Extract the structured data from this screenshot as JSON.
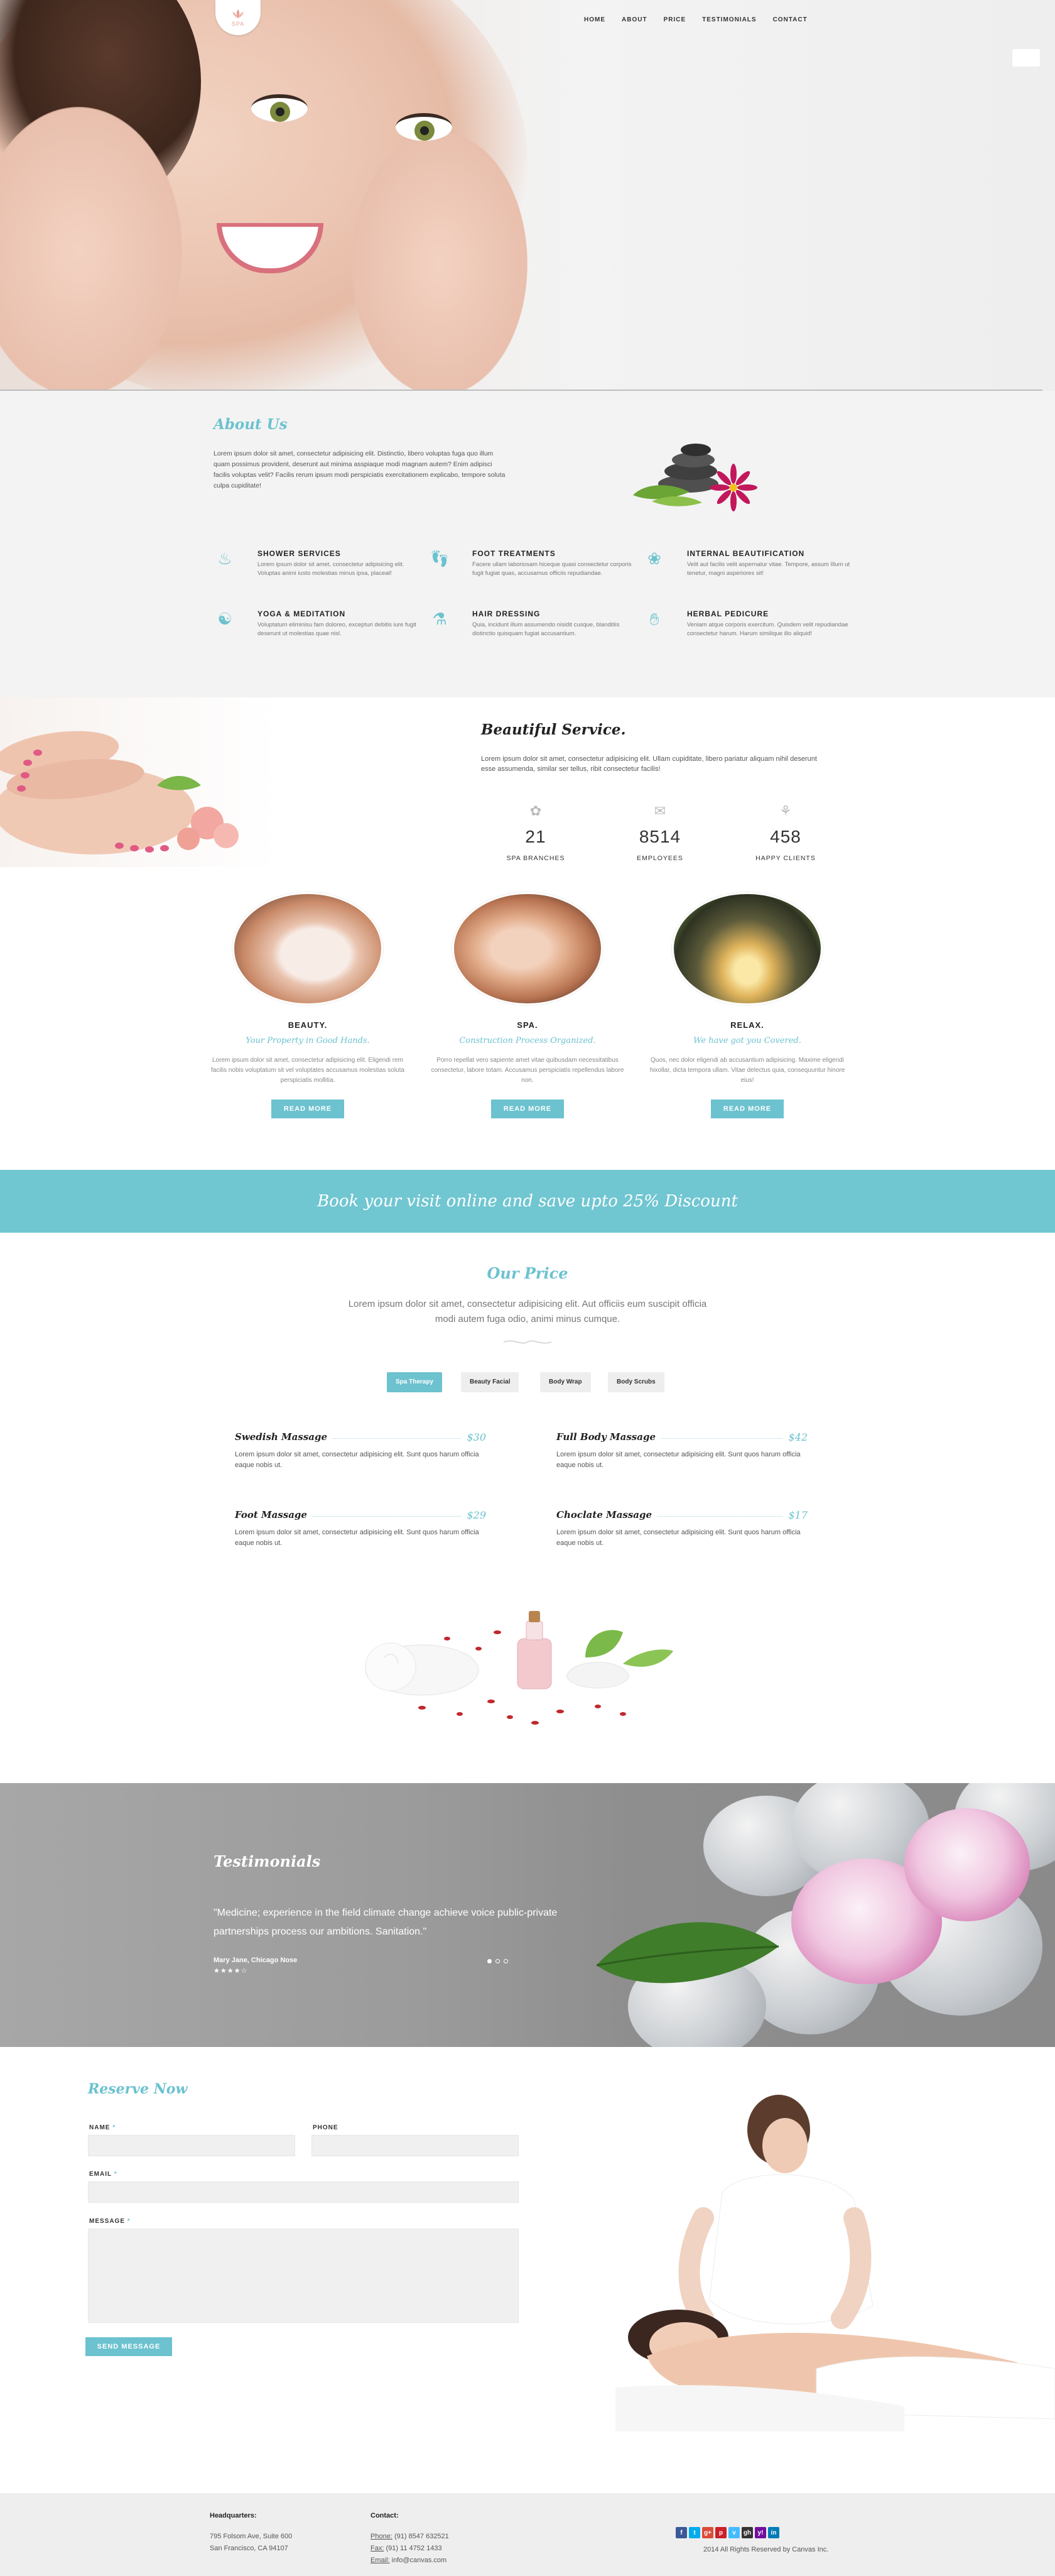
{
  "hero": {
    "logo_text": "SPA"
  },
  "nav": {
    "items": [
      "HOME",
      "ABOUT",
      "PRICE",
      "TESTIMONIALS",
      "CONTACT"
    ]
  },
  "about": {
    "title": "About Us",
    "text": "Lorem ipsum dolor sit amet, consectetur adipisicing elit. Distinctio, libero voluptas fuga quo illum quam possimus provident, deserunt aut minima asspiaque modi magnam autem? Enim adipisci facilis voluptas velit? Facilis rerum ipsum modi perspiciatis exercitationem explicabo, tempore soluta culpa cupiditate!",
    "features": [
      {
        "icon": "shower-icon",
        "title": "SHOWER SERVICES",
        "text": "Lorem ipsum dolor sit amet, consectetur adipisicing elit. Voluptas animi iusto molestias minus ipsa, placeat!"
      },
      {
        "icon": "feet-icon",
        "title": "FOOT TREATMENTS",
        "text": "Facere ullam laboriosam hiceque quasi consectetur corporis fugit fugiat quas, accusamus officiis repudiandae."
      },
      {
        "icon": "lotus-icon",
        "title": "INTERNAL BEAUTIFICATION",
        "text": "Velit aut facilis velit aspernatur vitae. Tempore, assum Illum ut tenetur, magni asperiores sit!"
      },
      {
        "icon": "yoga-icon",
        "title": "YOGA & MEDITATION",
        "text": "Voluptatum eliminisu fam doloreo, excepturi debitis iure fugit deserunt ut molestias quae nisl."
      },
      {
        "icon": "bottles-icon",
        "title": "HAIR DRESSING",
        "text": "Quia, incidunt illum assumendo nisidit cusque, blanditiis distinctio quisquam fugiat accusantium."
      },
      {
        "icon": "hand-icon",
        "title": "HERBAL PEDICURE",
        "text": "Veniam atque corporis exercitum. Quisdem velit repudiandae consectetur harum. Harum similique illo aliquid!"
      }
    ]
  },
  "beautiful": {
    "title": "Beautiful Service.",
    "text": "Lorem ipsum dolor sit amet, consectetur adipisicing elit. Ullam cupiditate, libero pariatur aliquam nihil deserunt esse assumenda, similar ser tellus, ribit consectetur facilis!",
    "counters": [
      {
        "icon": "flower-icon",
        "value": "21",
        "label": "SPA BRANCHES"
      },
      {
        "icon": "chat-icon",
        "value": "8514",
        "label": "EMPLOYEES"
      },
      {
        "icon": "meditation-icon",
        "value": "458",
        "label": "HAPPY CLIENTS"
      }
    ]
  },
  "services": [
    {
      "title": "BEAUTY.",
      "subtitle": "Your Property in Good Hands.",
      "text": "Lorem ipsum dolor sit amet, consectetur adipisicing elit. Eligendi rem facilis nobis voluptatum sit vel voluptates accusamus molestias soluta perspiciatis mollitia.",
      "button": "READ MORE"
    },
    {
      "title": "SPA.",
      "subtitle": "Construction Process Organized.",
      "text": "Porro repellat vero sapiente amet vitae quibusdam necessitatibus consectetur, labore totam. Accusamus perspiciatis repellendus labore non.",
      "button": "READ MORE"
    },
    {
      "title": "RELAX.",
      "subtitle": "We have got you Covered.",
      "text": "Quos, nec dolor eligendi ab accusantium adipisicing. Maxime eligendi hixollar, dicta tempora ullam. Vitae delectus quia, consequuntur hinore eius!",
      "button": "READ MORE"
    }
  ],
  "banner": {
    "text": "Book your visit online and save upto 25% Discount"
  },
  "price": {
    "title": "Our Price",
    "subtitle": "Lorem ipsum dolor sit amet, consectetur adipisicing elit. Aut officiis eum suscipit officia modi autem fuga odio, animi minus cumque.",
    "tabs": [
      "Spa Therapy",
      "Beauty Facial",
      "Body Wrap",
      "Body Scrubs"
    ],
    "items": [
      {
        "name": "Swedish Massage",
        "price": "$30",
        "text": "Lorem ipsum dolor sit amet, consectetur adipisicing elit. Sunt quos harum officia eaque nobis ut."
      },
      {
        "name": "Full Body Massage",
        "price": "$42",
        "text": "Lorem ipsum dolor sit amet, consectetur adipisicing elit. Sunt quos harum officia eaque nobis ut."
      },
      {
        "name": "Foot Massage",
        "price": "$29",
        "text": "Lorem ipsum dolor sit amet, consectetur adipisicing elit. Sunt quos harum officia eaque nobis ut."
      },
      {
        "name": "Choclate Massage",
        "price": "$17",
        "text": "Lorem ipsum dolor sit amet, consectetur adipisicing elit. Sunt quos harum officia eaque nobis ut."
      }
    ]
  },
  "testimonial": {
    "title": "Testimonials",
    "quote": "\"Medicine; experience in the field climate change achieve voice public-private partnerships process our ambitions. Sanitation.\"",
    "author": "Mary Jane, Chicago Nose",
    "stars": "★★★★☆"
  },
  "reserve": {
    "title": "Reserve Now",
    "name_label": "NAME",
    "phone_label": "PHONE",
    "email_label": "EMAIL",
    "message_label": "MESSAGE",
    "required_mark": "*",
    "button": "SEND MESSAGE"
  },
  "footer": {
    "hq_title": "Headquarters:",
    "hq_line1": "795 Folsom Ave, Suite 600",
    "hq_line2": "San Francisco, CA 94107",
    "contact_title": "Contact:",
    "phone_label": "Phone:",
    "phone": "(91) 8547 632521",
    "fax_label": "Fax:",
    "fax": "(91) 11 4752 1433",
    "email_label": "Email:",
    "email": "info@canvas.com",
    "copyright": "2014 All Rights Reserved by Canvas Inc.",
    "socials": [
      {
        "icon": "facebook-icon",
        "glyph": "f",
        "color": "#3b5998"
      },
      {
        "icon": "twitter-icon",
        "glyph": "t",
        "color": "#00aced"
      },
      {
        "icon": "googleplus-icon",
        "glyph": "g+",
        "color": "#dd4b39"
      },
      {
        "icon": "pinterest-icon",
        "glyph": "p",
        "color": "#cb2027"
      },
      {
        "icon": "vimeo-icon",
        "glyph": "v",
        "color": "#45bbff"
      },
      {
        "icon": "github-icon",
        "glyph": "gh",
        "color": "#333333"
      },
      {
        "icon": "yahoo-icon",
        "glyph": "y!",
        "color": "#720e9e"
      },
      {
        "icon": "linkedin-icon",
        "glyph": "in",
        "color": "#007bb6"
      }
    ]
  },
  "colors": {
    "accent": "#6cc2cf",
    "banner": "#70c6d1"
  }
}
